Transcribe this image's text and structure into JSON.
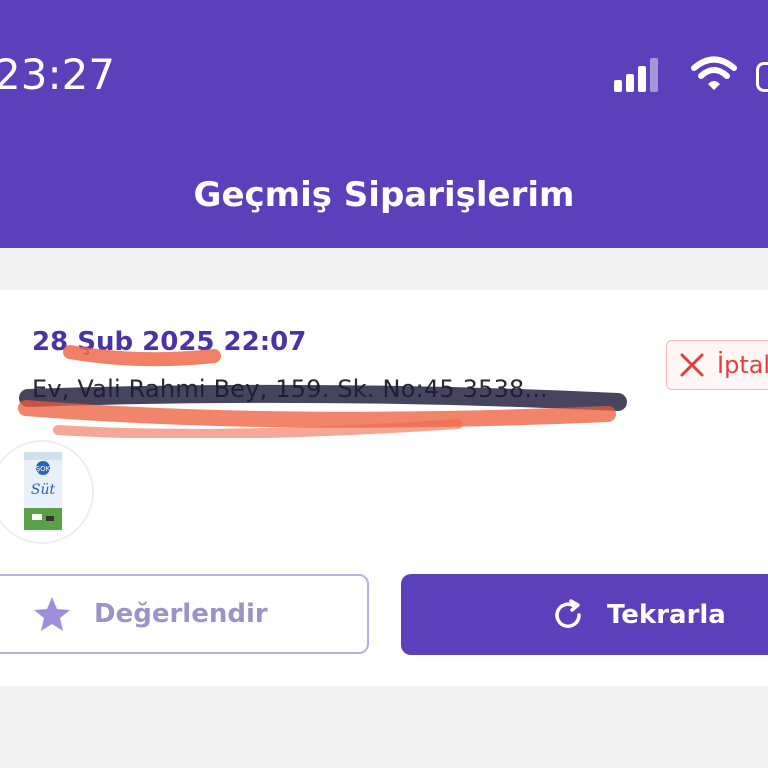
{
  "status_bar": {
    "time": "23:27",
    "icons": [
      "signal-icon",
      "wifi-icon",
      "battery-icon"
    ]
  },
  "header": {
    "title": "Geçmiş Siparişlerim",
    "background": "#5c3fbb"
  },
  "order": {
    "date": "28 Şub 2025 22:07",
    "address": "Ev, Vali Rahmi Bey, 159. Sk. No:45 3538...",
    "status": {
      "label": "İptal",
      "icon": "close-icon",
      "color": "#e0413f"
    },
    "product": {
      "image_label": "Süt",
      "brand": "ŞOK"
    },
    "actions": {
      "rate_label": "Değerlendir",
      "rate_icon": "star-icon",
      "repeat_label": "Tekrarla",
      "repeat_icon": "refresh-icon"
    }
  }
}
